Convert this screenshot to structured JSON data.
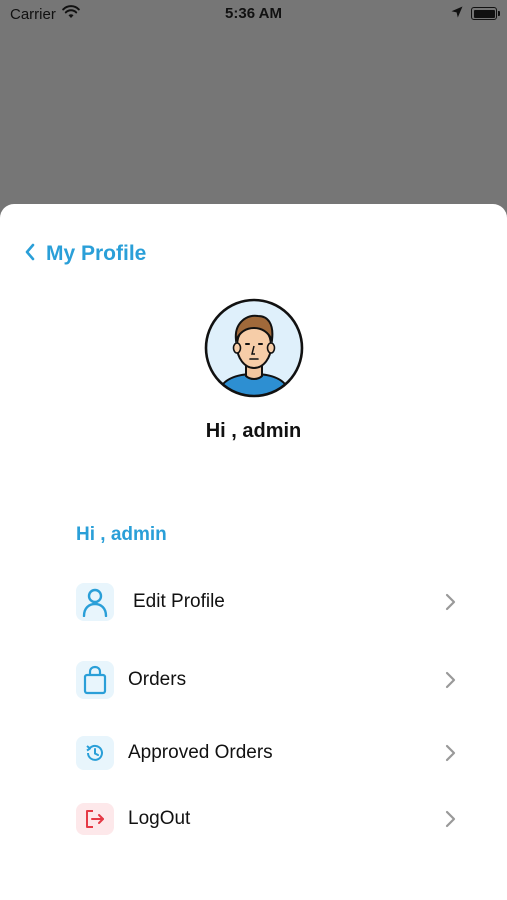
{
  "status_bar": {
    "carrier": "Carrier",
    "time": "5:36 AM"
  },
  "header": {
    "title": "My Profile"
  },
  "profile": {
    "greeting": "Hi , admin"
  },
  "menu": {
    "greeting": "Hi , admin",
    "items": [
      {
        "label": "Edit Profile",
        "icon": "person-icon"
      },
      {
        "label": "Orders",
        "icon": "shopping-bag-icon"
      },
      {
        "label": "Approved Orders",
        "icon": "history-icon"
      },
      {
        "label": "LogOut",
        "icon": "logout-icon"
      }
    ]
  },
  "colors": {
    "accent": "#2a9fd8",
    "icon_bg_blue": "#e8f5fc",
    "icon_bg_red": "#fde8ea",
    "logout_red": "#e53945",
    "overlay": "#767676"
  }
}
